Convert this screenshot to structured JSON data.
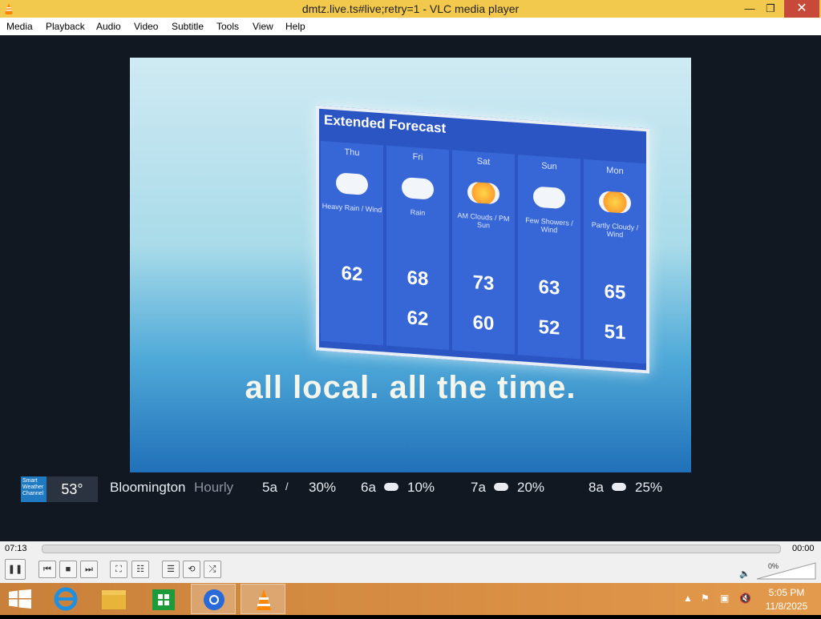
{
  "window": {
    "title": "dmtz.live.ts#live;retry=1 - VLC media player"
  },
  "titlebar_buttons": {
    "minimize": "—",
    "maximize": "❐",
    "close": "✕"
  },
  "menu": [
    "Media",
    "Playback",
    "Audio",
    "Video",
    "Subtitle",
    "Tools",
    "View",
    "Help"
  ],
  "video": {
    "forecast_title": "Extended Forecast",
    "days": [
      {
        "day": "Thu",
        "condition": "Heavy Rain / Wind",
        "high": "62",
        "low": ""
      },
      {
        "day": "Fri",
        "condition": "Rain",
        "high": "68",
        "low": "62"
      },
      {
        "day": "Sat",
        "condition": "AM Clouds / PM Sun",
        "high": "73",
        "low": "60"
      },
      {
        "day": "Sun",
        "condition": "Few Showers / Wind",
        "high": "63",
        "low": "52"
      },
      {
        "day": "Mon",
        "condition": "Partly Cloudy / Wind",
        "high": "65",
        "low": "51"
      }
    ],
    "slogan": "all local. all the time.",
    "ticker": {
      "logo_text": "Smart Weather Channel",
      "current_temp": "53°",
      "city": "Bloomington",
      "label": "Hourly",
      "hours": [
        {
          "time": "5a",
          "pct": "30%"
        },
        {
          "time": "6a",
          "pct": "10%"
        },
        {
          "time": "7a",
          "pct": "20%"
        },
        {
          "time": "8a",
          "pct": "25%"
        }
      ]
    }
  },
  "playback": {
    "elapsed": "07:13",
    "remaining": "00:00",
    "progress": 0,
    "volume": "0%"
  },
  "controls": {
    "pause": "❚❚",
    "prev": "⏮",
    "stop": "■",
    "next": "⏭",
    "fullscreen": "⛶",
    "extended": "☷",
    "playlist": "☰",
    "loop": "⟲",
    "random": "⤮"
  },
  "taskbar": {
    "time": "5:05 PM",
    "date": "11/8/2025"
  },
  "colors": {
    "titlebar": "#f2c94c",
    "close": "#c7493a",
    "taskbar": "#d88c42",
    "panel": "#2a55c2"
  }
}
